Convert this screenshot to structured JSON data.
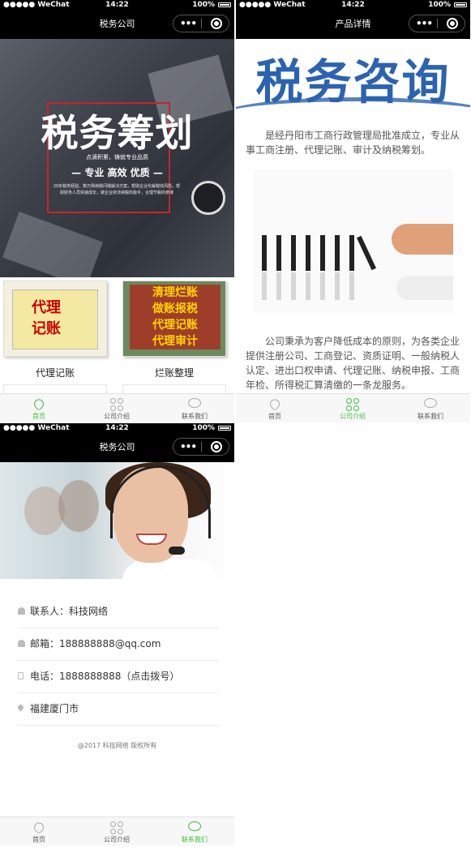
{
  "status_bar": {
    "carrier": "●●●●● WeChat",
    "time": "14:22",
    "battery": "100%"
  },
  "capsule": {
    "dots": "•••"
  },
  "tabs": [
    {
      "label": "首页",
      "icon": "heart-icon"
    },
    {
      "label": "公司介绍",
      "icon": "grid-icon"
    },
    {
      "label": "联系我们",
      "icon": "chat-bubble-icon"
    }
  ],
  "accent_color": "#3fbd3f",
  "home": {
    "nav_title": "税务公司",
    "banner": {
      "title": "税务筹划",
      "subtitle": "点滴积累，铸就专业品质",
      "tagline": "— 专业 高效 优质 —",
      "body": "20年税务经验，数万例纳税问题解决方案，帮助企业化解税收风险，帮助财务人员快速成长，做企业依法纳税的能手，合理节税的参谋"
    },
    "services": [
      {
        "label": "代理记账",
        "image_text": "代理\n记账"
      },
      {
        "label": "烂账整理",
        "image_text": "清理烂账\n做账报税\n代理记账\n代理审计"
      }
    ]
  },
  "detail": {
    "nav_title": "产品详情",
    "hero_word": "税务咨询",
    "intro": "是经丹阳市工商行政管理局批准成立，专业从事工商注册、代理记账、审计及纳税筹划。",
    "body": "公司秉承为客户降低成本的原则，为各类企业提供注册公司、工商登记、资质证明、一般纳税人认定、进出口权申请、代理记账、纳税申报、工商年检、所得税汇算清缴的一条龙服务。"
  },
  "contact": {
    "nav_title": "税务公司",
    "rows": [
      {
        "icon": "person-icon",
        "text": "联系人：科技网络"
      },
      {
        "icon": "bell-icon",
        "text": "邮箱：188888888@qq.com"
      },
      {
        "icon": "phone-icon",
        "text": "电话：1888888888（点击拨号）"
      },
      {
        "icon": "location-pin-icon",
        "text": "福建厦门市"
      }
    ],
    "copyright": "@2017 科技网络 版权所有"
  }
}
